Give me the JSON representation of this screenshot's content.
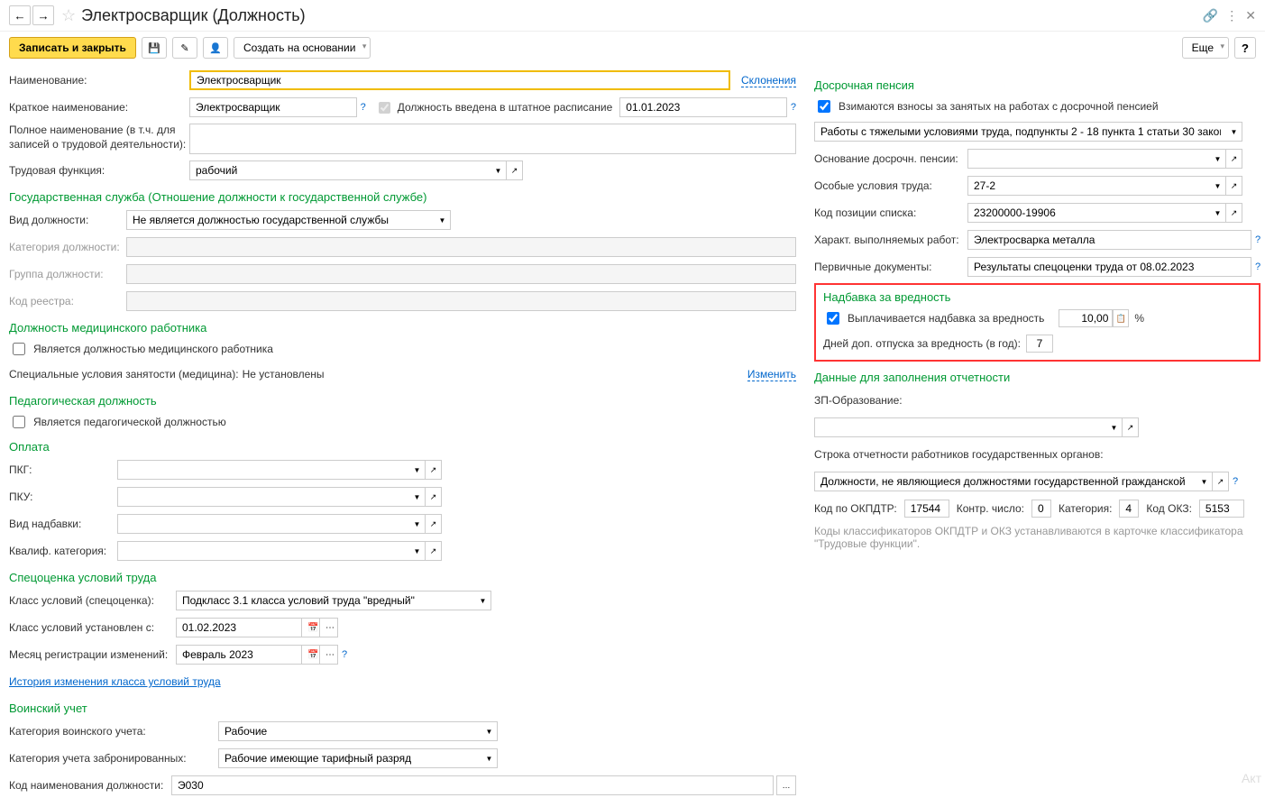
{
  "header": {
    "title": "Электросварщик (Должность)"
  },
  "toolbar": {
    "save_close": "Записать и закрыть",
    "create_based": "Создать на основании",
    "more": "Еще",
    "help": "?"
  },
  "fields": {
    "name_label": "Наименование:",
    "name_value": "Электросварщик",
    "declensions": "Склонения",
    "short_name_label": "Краткое наименование:",
    "short_name_value": "Электросварщик",
    "staffing_checkbox": "Должность введена в штатное расписание",
    "staffing_date": "01.01.2023",
    "full_name_label": "Полное наименование (в т.ч. для записей о трудовой деятельности):",
    "labor_function_label": "Трудовая функция:",
    "labor_function_value": "рабочий"
  },
  "gov_service": {
    "header": "Государственная служба (Отношение должности к государственной службе)",
    "position_type_label": "Вид должности:",
    "position_type_value": "Не является должностью государственной службы",
    "category_label": "Категория должности:",
    "group_label": "Группа должности:",
    "registry_code_label": "Код реестра:"
  },
  "medical": {
    "header": "Должность медицинского работника",
    "is_medical": "Является должностью медицинского работника",
    "special_conditions_label": "Специальные условия занятости (медицина):",
    "special_conditions_value": "Не установлены",
    "change_link": "Изменить"
  },
  "pedagogical": {
    "header": "Педагогическая должность",
    "is_pedagogical": "Является педагогической должностью"
  },
  "payment": {
    "header": "Оплата",
    "pkg_label": "ПКГ:",
    "pku_label": "ПКУ:",
    "allowance_type_label": "Вид надбавки:",
    "qualif_category_label": "Квалиф. категория:"
  },
  "spec_assessment": {
    "header": "Спецоценка условий труда",
    "class_label": "Класс условий (спецоценка):",
    "class_value": "Подкласс 3.1 класса условий труда \"вредный\"",
    "set_from_label": "Класс условий установлен с:",
    "set_from_value": "01.02.2023",
    "month_reg_label": "Месяц регистрации изменений:",
    "month_reg_value": "Февраль 2023",
    "history_link": "История изменения класса условий труда"
  },
  "military": {
    "header": "Воинский учет",
    "category_label": "Категория воинского учета:",
    "category_value": "Рабочие",
    "reserved_category_label": "Категория учета забронированных:",
    "reserved_category_value": "Рабочие имеющие тарифный разряд",
    "code_label": "Код наименования должности:",
    "code_value": "Э030"
  },
  "early_pension": {
    "header": "Досрочная пенсия",
    "charge_checkbox": "Взимаются взносы за занятых на работах с досрочной пенсией",
    "work_type_value": "Работы с тяжелыми условиями труда, подпункты 2 - 18 пункта 1 статьи 30 закон",
    "basis_label": "Основание досрочн. пенсии:",
    "special_conditions_label": "Особые условия труда:",
    "special_conditions_value": "27-2",
    "list_code_label": "Код позиции списка:",
    "list_code_value": "23200000-19906",
    "work_nature_label": "Характ. выполняемых работ:",
    "work_nature_value": "Электросварка металла",
    "primary_docs_label": "Первичные документы:",
    "primary_docs_value": "Результаты спецоценки труда от 08.02.2023"
  },
  "hazard": {
    "header": "Надбавка за вредность",
    "paid_checkbox": "Выплачивается надбавка за вредность",
    "percent_value": "10,00",
    "percent_sign": "%",
    "extra_days_label": "Дней доп. отпуска за вредность (в год):",
    "extra_days_value": "7"
  },
  "reporting": {
    "header": "Данные для заполнения отчетности",
    "zp_education_label": "ЗП-Образование:",
    "gov_line_label": "Строка отчетности работников государственных органов:",
    "gov_line_value": "Должности, не являющиеся должностями государственной гражданской",
    "okpdtr_label": "Код по ОКПДТР:",
    "okpdtr_value": "17544",
    "control_label": "Контр. число:",
    "control_value": "0",
    "category_label": "Категория:",
    "category_value": "4",
    "okz_label": "Код ОКЗ:",
    "okz_value": "5153",
    "note": "Коды классификаторов ОКПДТР и ОКЗ устанавливаются в карточке классификатора \"Трудовые функции\"."
  },
  "watermark": "Акт"
}
